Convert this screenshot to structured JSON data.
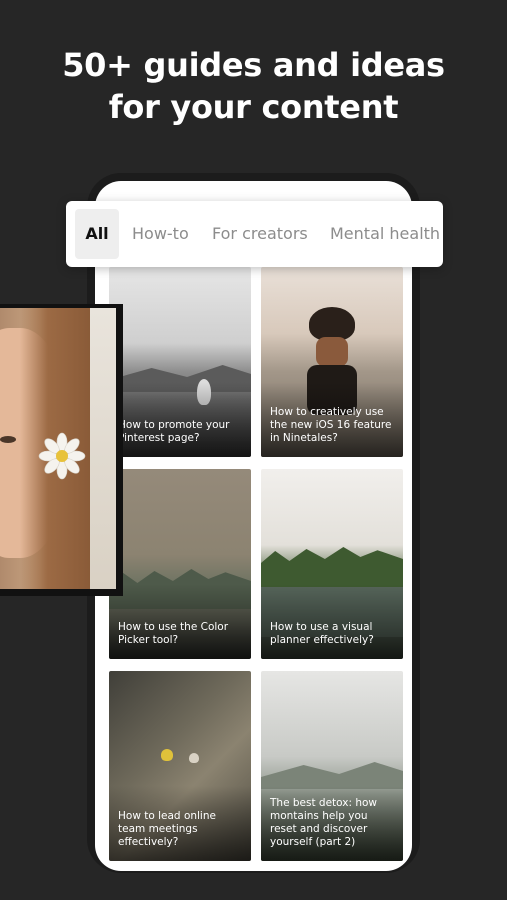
{
  "headline": {
    "line1": "50+ guides and ideas",
    "line2": "for your content"
  },
  "tabs": [
    {
      "label": "All",
      "active": true
    },
    {
      "label": "How-to",
      "active": false
    },
    {
      "label": "For creators",
      "active": false
    },
    {
      "label": "Mental health",
      "active": false
    }
  ],
  "cards": [
    {
      "caption": "How to promote your Pinterest page?"
    },
    {
      "caption": "How to creatively use the new iOS 16 feature in Ninetales?"
    },
    {
      "caption": "How to use the Color Picker tool?"
    },
    {
      "caption": "How to use a visual planner effectively?"
    },
    {
      "caption": "How to lead online team meetings effectively?"
    },
    {
      "caption": "The best detox: how montains help you reset and discover yourself (part 2)"
    }
  ],
  "colors": {
    "background": "#262626",
    "text": "#ffffff",
    "tab_active_bg": "#eeeeee"
  }
}
